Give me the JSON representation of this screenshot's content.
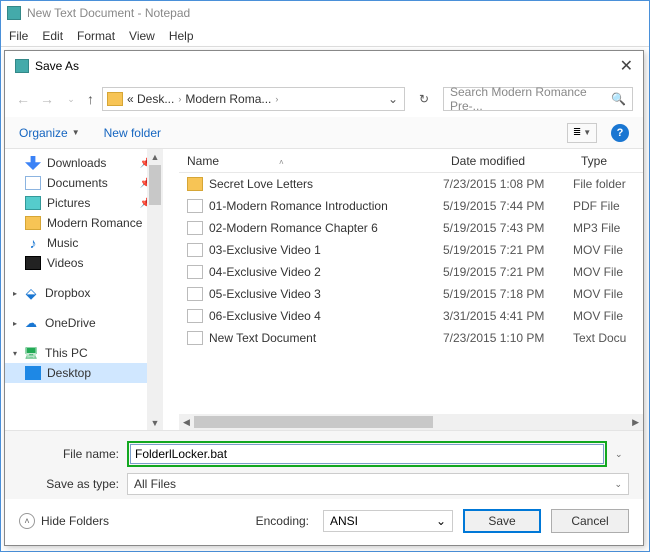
{
  "notepad": {
    "title": "New Text Document - Notepad",
    "menu": {
      "file": "File",
      "edit": "Edit",
      "format": "Format",
      "view": "View",
      "help": "Help"
    }
  },
  "dialog": {
    "title": "Save As",
    "breadcrumb": {
      "seg1": "«  Desk...",
      "seg2": "Modern Roma...",
      "dropdown": "⌄"
    },
    "search_placeholder": "Search Modern Romance Pre-...",
    "toolbar": {
      "organize": "Organize",
      "new_folder": "New folder"
    },
    "sidebar": {
      "downloads": "Downloads",
      "documents": "Documents",
      "pictures": "Pictures",
      "modern_romance": "Modern Romance",
      "music": "Music",
      "videos": "Videos",
      "dropbox": "Dropbox",
      "onedrive": "OneDrive",
      "this_pc": "This PC",
      "desktop": "Desktop"
    },
    "columns": {
      "name": "Name",
      "date": "Date modified",
      "type": "Type"
    },
    "rows": [
      {
        "icon": "folder",
        "name": "Secret Love Letters",
        "date": "7/23/2015 1:08 PM",
        "type": "File folder"
      },
      {
        "icon": "file",
        "name": "01-Modern Romance Introduction",
        "date": "5/19/2015 7:44 PM",
        "type": "PDF File"
      },
      {
        "icon": "file",
        "name": "02-Modern Romance Chapter 6",
        "date": "5/19/2015 7:43 PM",
        "type": "MP3 File"
      },
      {
        "icon": "file",
        "name": "03-Exclusive Video 1",
        "date": "5/19/2015 7:21 PM",
        "type": "MOV File"
      },
      {
        "icon": "file",
        "name": "04-Exclusive Video 2",
        "date": "5/19/2015 7:21 PM",
        "type": "MOV File"
      },
      {
        "icon": "file",
        "name": "05-Exclusive Video 3",
        "date": "5/19/2015 7:18 PM",
        "type": "MOV File"
      },
      {
        "icon": "file",
        "name": "06-Exclusive Video 4",
        "date": "3/31/2015 4:41 PM",
        "type": "MOV File"
      },
      {
        "icon": "file",
        "name": "New Text Document",
        "date": "7/23/2015 1:10 PM",
        "type": "Text Docu"
      }
    ],
    "file_name_label": "File name:",
    "file_name_value": "FolderlLocker.bat",
    "save_type_label": "Save as type:",
    "save_type_value": "All Files",
    "hide_folders": "Hide Folders",
    "encoding_label": "Encoding:",
    "encoding_value": "ANSI",
    "save": "Save",
    "cancel": "Cancel"
  }
}
